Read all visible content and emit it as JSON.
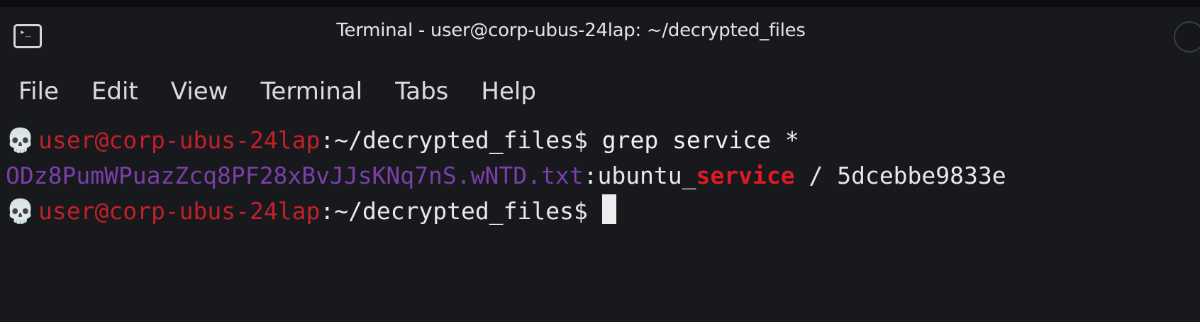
{
  "window": {
    "title": "Terminal - user@corp-ubus-24lap: ~/decrypted_files",
    "app_icon": "terminal-icon",
    "title_icon_glyph": "▸_"
  },
  "menu": {
    "items": [
      "File",
      "Edit",
      "View",
      "Terminal",
      "Tabs",
      "Help"
    ]
  },
  "terminal": {
    "prompt_icon_glyph": "💀",
    "lines": [
      {
        "user_host": "user@corp-ubus-24lap",
        "path": ":~/decrypted_files$",
        "command": " grep service *"
      },
      {
        "filename": "ODz8PumWPuazZcq8PF28xBvJJsKNq7nS.wNTD.txt",
        "separator": ":",
        "before_match": "ubuntu_",
        "match": "service",
        "after_match": " / 5dcebbe9833e"
      },
      {
        "user_host": "user@corp-ubus-24lap",
        "path": ":~/decrypted_files$",
        "command": " "
      }
    ]
  },
  "colors": {
    "background": "#17191d",
    "user_host": "#c4202a",
    "filename": "#7a3fa8",
    "match_highlight": "#e01a24",
    "text": "#e8e8e8"
  }
}
